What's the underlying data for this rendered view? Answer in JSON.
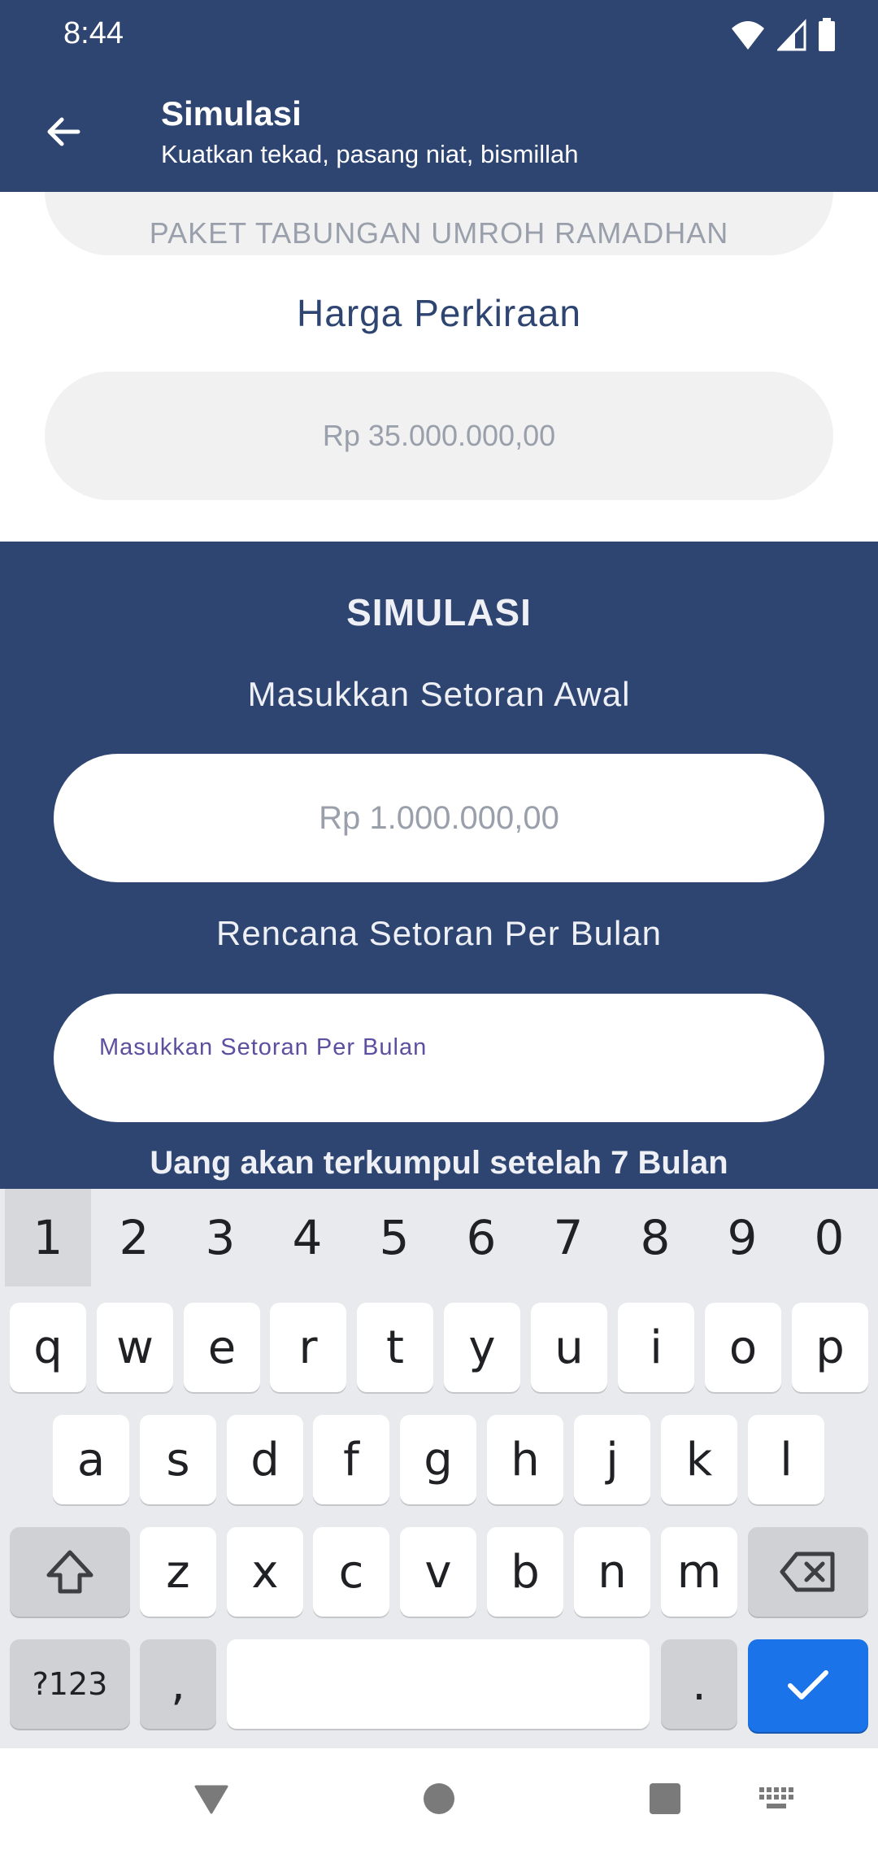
{
  "status_bar": {
    "time": "8:44",
    "icons": [
      "wifi-icon",
      "signal-icon",
      "battery-icon"
    ]
  },
  "app_bar": {
    "title": "Simulasi",
    "subtitle": "Kuatkan tekad, pasang niat, bismillah",
    "back_icon": "arrow-back-icon"
  },
  "form": {
    "package_value": "PAKET TABUNGAN UMROH RAMADHAN",
    "harga_label": "Harga Perkiraan",
    "harga_value": "Rp 35.000.000,00"
  },
  "simulasi": {
    "title": "SIMULASI",
    "setoran_awal_label": "Masukkan Setoran Awal",
    "setoran_awal_value": "Rp 1.000.000,00",
    "rencana_label": "Rencana Setoran Per Bulan",
    "rencana_hint": "Masukkan Setoran Per Bulan",
    "result": "Uang akan terkumpul setelah  7 Bulan"
  },
  "keyboard": {
    "number_row": [
      "1",
      "2",
      "3",
      "4",
      "5",
      "6",
      "7",
      "8",
      "9",
      "0"
    ],
    "row1": [
      "q",
      "w",
      "e",
      "r",
      "t",
      "y",
      "u",
      "i",
      "o",
      "p"
    ],
    "row2": [
      "a",
      "s",
      "d",
      "f",
      "g",
      "h",
      "j",
      "k",
      "l"
    ],
    "row3": [
      "z",
      "x",
      "c",
      "v",
      "b",
      "n",
      "m"
    ],
    "symbols_key": "?123",
    "comma_key": ",",
    "period_key": ".",
    "accent_color": "#1a73e8"
  },
  "colors": {
    "primary": "#2e4572",
    "input_grey": "#f1f1f1",
    "hint_purple": "#5d4ea0"
  }
}
